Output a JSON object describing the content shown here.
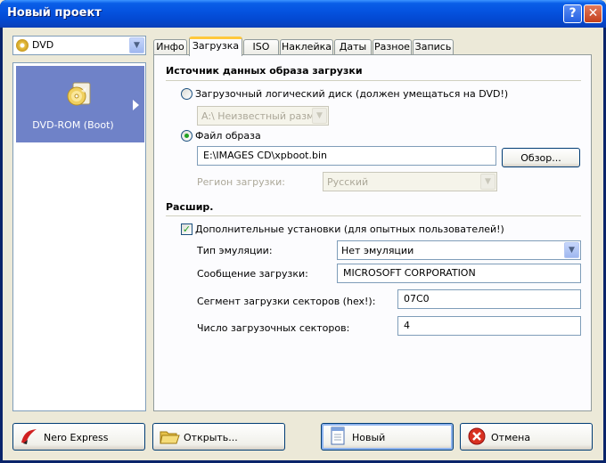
{
  "window": {
    "title": "Новый проект"
  },
  "left": {
    "format_select": "DVD",
    "items": [
      {
        "label": "DVD-ROM (Boot)"
      }
    ]
  },
  "tabs": [
    {
      "label": "Инфо"
    },
    {
      "label": "Загрузка"
    },
    {
      "label": "ISO"
    },
    {
      "label": "Наклейка"
    },
    {
      "label": "Даты"
    },
    {
      "label": "Разное"
    },
    {
      "label": "Запись"
    }
  ],
  "boot": {
    "section_title": "Источник данных образа загрузки",
    "logical_disk_label": "Загрузочный логический диск (должен умещаться на DVD!)",
    "drive_select": "A:\\  Неизвестный размер",
    "image_file_label": "Файл образа",
    "image_path": "E:\\IMAGES CD\\xpboot.bin",
    "browse_label": "Обзор...",
    "region_label": "Регион загрузки:",
    "region_select": "Русский"
  },
  "advanced": {
    "section_title": "Расшир.",
    "enable_label": "Дополнительные установки (для опытных пользователей!)",
    "emulation_label": "Тип эмуляции:",
    "emulation_value": "Нет эмуляции",
    "message_label": "Сообщение загрузки:",
    "message_value": "MICROSOFT CORPORATION",
    "segment_label": "Сегмент загрузки секторов (hex!):",
    "segment_value": "07C0",
    "sectors_label": "Число загрузочных секторов:",
    "sectors_value": "4"
  },
  "footer": {
    "nero_express": "Nero Express",
    "open": "Открыть...",
    "new": "Новый",
    "cancel": "Отмена"
  }
}
